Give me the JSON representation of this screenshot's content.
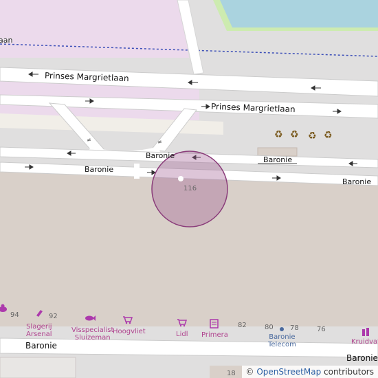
{
  "map": {
    "streets": {
      "prinses_top": "Prinses Margrietlaan",
      "prinses_bottom": "Prinses Margrietlaan",
      "baronie_center": "Baronie",
      "baronie_box": "Baronie",
      "baronie_left": "Baronie",
      "baronie_right": "Baronie",
      "baronie_bottom_left": "Baronie",
      "baronie_bottom_right": "Baronie",
      "top_left_fragment": "aan"
    },
    "house_numbers": {
      "n116": "116",
      "n94": "94",
      "n92": "92",
      "n82": "82",
      "n80": "80",
      "n78": "78",
      "n76": "76",
      "n18": "18"
    },
    "pois": {
      "slagerij_line1": "Slagerij",
      "slagerij_line2": "Arsenal",
      "visspecialist_line1": "Visspecialist",
      "visspecialist_line2": "Sluizeman",
      "hoogvliet": "Hoogvliet",
      "lidl": "Lidl",
      "primera": "Primera",
      "telecom_line1": "Baronie",
      "telecom_line2": "Telecom",
      "kruidvat": "Kruidvat"
    },
    "icons": {
      "recycling": "recycling-icon",
      "bakery": "bakery-icon",
      "butcher": "butcher-icon",
      "fish": "fish-icon",
      "supermarket": "supermarket-icon",
      "newsagent": "newsagent-icon",
      "chemist": "chemist-icon",
      "location_marker": "location-circle"
    },
    "colors": {
      "retail": "#d9d0c9",
      "residential_pink": "#ecdaec",
      "water": "#aad3df",
      "grass": "#cdebb0",
      "road": "#ffffff",
      "poi": "#ac39ac",
      "marker": "#9e5a8f"
    }
  },
  "attribution": {
    "symbol": "©",
    "link": "OpenStreetMap",
    "suffix": "contributors"
  }
}
